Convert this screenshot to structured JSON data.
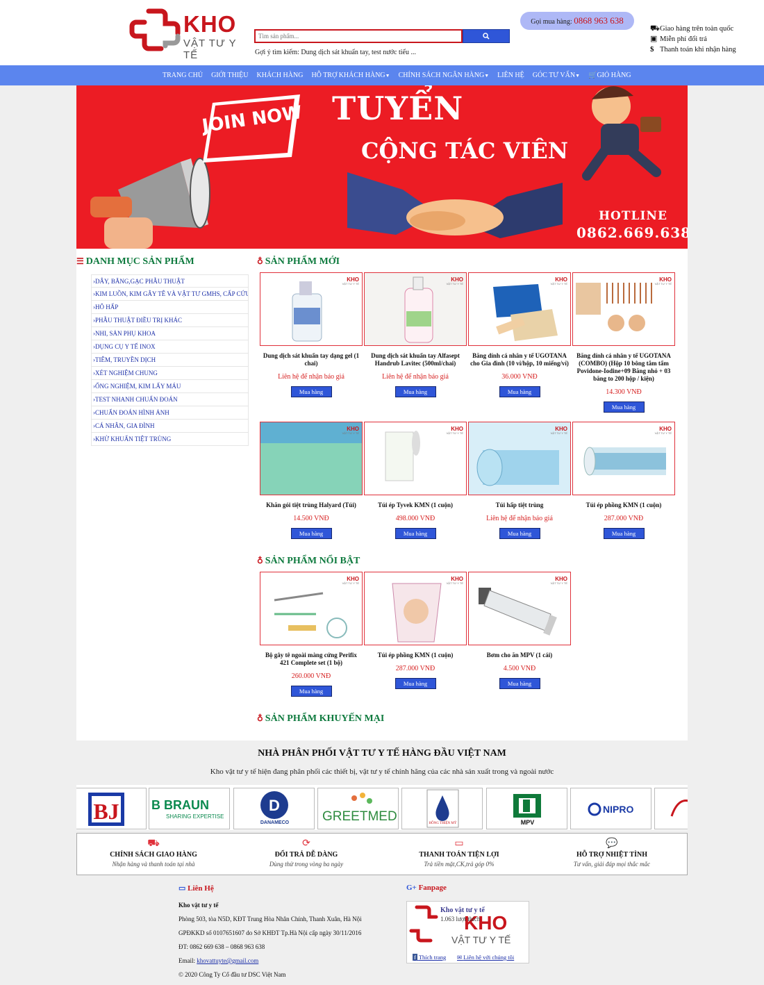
{
  "header": {
    "logo_main": "KHO",
    "logo_sub": "VẬT TƯ Y TẾ",
    "search_placeholder": "Tìm sản phẩm...",
    "search_suggest": "Gợi ý tìm kiếm: Dung dịch sát khuẩn tay, test nước tiểu ...",
    "hotline_label": "Gọi mua hàng:",
    "hotline_number": "0868 963 638",
    "features": [
      {
        "icon": "truck-icon",
        "text": "Giao hàng trên toàn quốc"
      },
      {
        "icon": "box-icon",
        "text": "Miễn phí đổi trả"
      },
      {
        "icon": "dollar-icon",
        "text": "Thanh toán khi nhận hàng"
      }
    ]
  },
  "nav": {
    "items": [
      {
        "label": "TRANG CHỦ"
      },
      {
        "label": "GIỚI THIỆU"
      },
      {
        "label": "KHÁCH HÀNG"
      },
      {
        "label": "HỖ TRỢ KHÁCH HÀNG"
      },
      {
        "label": "CHÍNH SÁCH NGÂN HÀNG"
      },
      {
        "label": "LIÊN HỆ"
      },
      {
        "label": "GÓC TƯ VẤN"
      },
      {
        "label": "GIỎ HÀNG"
      }
    ]
  },
  "banner": {
    "join": "JOIN NOW",
    "title": "TUYỂN",
    "subtitle": "CỘNG TÁC VIÊN",
    "hotline_label": "HOTLINE",
    "hotline_number": "0862.669.638"
  },
  "sidebar": {
    "title": "DANH MỤC SẢN PHẨM",
    "categories": [
      "›DÂY, BĂNG,GẠC PHẪU THUẬT",
      "›KIM LUỒN, KIM GÂY TÊ VÀ VẬT TƯ GMHS, CẤP CỨU",
      "›HÔ HẤP",
      "›PHẪU THUẬT ĐIỀU TRỊ KHÁC",
      "›NHI, SẢN PHỤ KHOA",
      "›DỤNG CỤ Y TẾ INOX",
      "›TIÊM, TRUYỀN DỊCH",
      "›XÉT NGHIỆM CHUNG",
      "›ỐNG NGHIỆM, KIM LẤY MÁU",
      "›TEST NHANH CHUẨN ĐOÁN",
      "›CHUẨN ĐOÁN HÌNH ẢNH",
      "›CÁ NHÂN, GIA ĐÌNH",
      "›KHỬ KHUẨN TIỆT TRÙNG"
    ]
  },
  "sections": {
    "new": "SẢN PHẨM MỚI",
    "featured": "SẢN PHẨM NỔI BẬT",
    "promo": "SẢN PHẨM KHUYẾN MẠI"
  },
  "buy_label": "Mua hàng",
  "watermark": {
    "main": "KHO",
    "sub": "VẬT TƯ Y TẾ"
  },
  "new_products": [
    {
      "name": "Dung dịch sát khuẩn tay dạng gel (1 chai)",
      "price": "Liên hệ để nhận báo giá"
    },
    {
      "name": "Dung dịch sát khuẩn tay Alfasept Handrub Lavitec (500ml/chai)",
      "price": "Liên hệ để nhận báo giá"
    },
    {
      "name": "Băng dính cá nhân y tế UGOTANA cho Gia đình (10 vỉ/hộp, 10 miếng/vỉ)",
      "price": "36.000 VNĐ"
    },
    {
      "name": "Băng dính cá nhân y tế UGOTANA (COMBO) (Hộp 10 bông tắm tẩm Povidone-Iodine+09 Băng nhỏ + 03 băng to 200 hộp / kiện)",
      "price": "14.300 VNĐ"
    },
    {
      "name": "Khăn gói tiệt trùng Halyard (Túi)",
      "price": "14.500 VNĐ"
    },
    {
      "name": "Túi ép Tyvek KMN (1 cuộn)",
      "price": "498.000 VNĐ"
    },
    {
      "name": "Túi hấp tiệt trùng",
      "price": "Liên hệ để nhận báo giá"
    },
    {
      "name": "Túi ép phồng KMN (1 cuộn)",
      "price": "287.000 VNĐ"
    }
  ],
  "featured_products": [
    {
      "name": "Bộ gây tê ngoài màng cứng Perifix 421 Complete set (1 bộ)",
      "price": "260.000 VNĐ"
    },
    {
      "name": "Túi ép phồng KMN (1 cuộn)",
      "price": "287.000 VNĐ"
    },
    {
      "name": "Bơm cho ăn MPV (1 cái)",
      "price": "4.500 VNĐ"
    }
  ],
  "distributor": {
    "title": "NHÀ PHÂN PHỐI VẬT TƯ Y TẾ HÀNG ĐẦU VIỆT NAM",
    "subtitle": "Kho vật tư y tế hiện đang phân phối các thiết bị, vật tư y tế chính hãng của các nhà sản xuất trong và ngoài nước",
    "brands": [
      "B BRAUN",
      "SHARING EXPERTISE",
      "DANAMECO",
      "GREETMED",
      "HỒNG THIỆN MỸ",
      "MPV",
      "NIPRO"
    ]
  },
  "services": [
    {
      "title": "CHÍNH SÁCH GIAO HÀNG",
      "desc": "Nhận hàng và thanh toán tại nhà"
    },
    {
      "title": "ĐỔI TRẢ DỄ DÀNG",
      "desc": "Dùng thử trong vòng ba ngày"
    },
    {
      "title": "THANH TOÁN TIỆN LỢI",
      "desc": "Trả tiền mặt,CK,trả góp 0%"
    },
    {
      "title": "HỖ TRỢ NHIỆT TÌNH",
      "desc": "Tư vấn, giải đáp mọi thắc mắc"
    }
  ],
  "footer": {
    "contact_title": "Liên Hệ",
    "company": "Kho vật tư y tế",
    "address": "Phòng 503, tòa N5D, KĐT Trung Hòa Nhân Chính, Thanh Xuân, Hà Nội",
    "license": "GPĐKKD số 0107651607 do Sở KHĐT Tp.Hà Nội cấp ngày 30/11/2016",
    "phone": "ĐT: 0862 669 638 – 0868 963 638",
    "email_label": "Email:",
    "email": "khovattuyte@gmail.com",
    "copyright": "© 2020 Công Ty Cổ đầu tư DSC Việt Nam",
    "fanpage_title": "Fanpage",
    "fan_name": "Kho vật tư y tế",
    "fan_likes": "1.063 lượt thích",
    "fan_like_btn": "Thích trang",
    "fan_contact_btn": "Liên hệ với chúng tôi"
  }
}
